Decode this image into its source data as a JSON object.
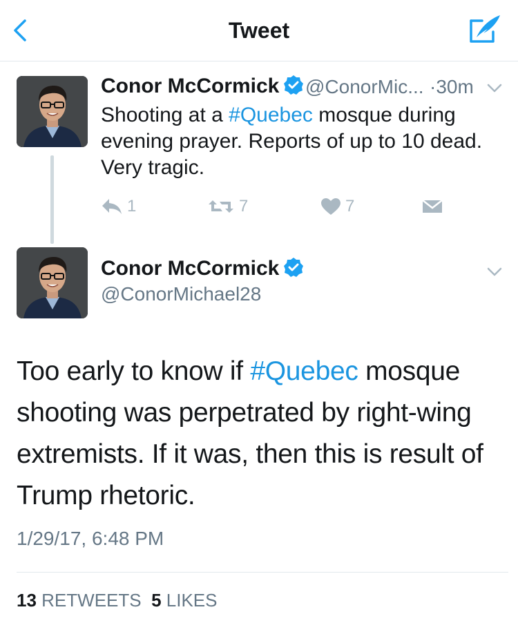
{
  "navbar": {
    "title": "Tweet",
    "back_icon": "chevron-left-icon",
    "compose_icon": "compose-tweet-icon",
    "accent": "#1da1f2"
  },
  "parent_tweet": {
    "name": "Conor McCormick",
    "handle": "@ConorMic...",
    "time": "·30m",
    "text_before": "Shooting at a ",
    "hashtag": "#Quebec",
    "text_after": " mosque during evening prayer. Reports of up to 10 dead. Very tragic.",
    "actions": {
      "replies": "1",
      "retweets": "7",
      "likes": "7"
    }
  },
  "main_tweet": {
    "name": "Conor McCormick",
    "handle": "@ConorMichael28",
    "text_before": "Too early to know if ",
    "hashtag": "#Quebec",
    "text_after": " mosque shooting was perpetrated by right-wing extremists. If it was, then this is result of Trump rhetoric.",
    "timestamp": "1/29/17, 6:48 PM",
    "stats": {
      "retweets_count": "13",
      "retweets_label": "RETWEETS",
      "likes_count": "5",
      "likes_label": "LIKES"
    }
  },
  "colors": {
    "link": "#1b95e0",
    "secondary_text": "#657786",
    "icon_gray": "#aab8c2",
    "verified": "#1da1f2"
  }
}
